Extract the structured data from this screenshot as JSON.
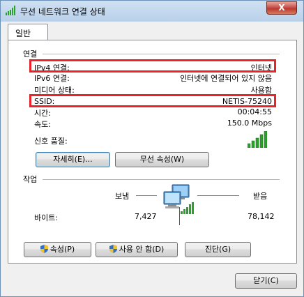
{
  "window": {
    "title": "무선 네트워크 연결 상태",
    "close_label": "X"
  },
  "tab": {
    "label": "일반"
  },
  "connection": {
    "section_label": "연결",
    "rows": [
      {
        "label": "IPv4 연결:",
        "value": "인터넷"
      },
      {
        "label": "IPv6 연결:",
        "value": "인터넷에 연결되어 있지 않음"
      },
      {
        "label": "미디어 상태:",
        "value": "사용함"
      },
      {
        "label": "SSID:",
        "value": "NETIS-75240"
      },
      {
        "label": "시간:",
        "value": "00:04:55"
      },
      {
        "label": "속도:",
        "value": "150.0 Mbps"
      }
    ],
    "signal_label": "신호 품질:",
    "signal_bars": 5,
    "details_button": "자세히(E)...",
    "wireless_props_button": "무선 속성(W)"
  },
  "activity": {
    "section_label": "작업",
    "sent_label": "보냄",
    "received_label": "받음",
    "bytes_label": "바이트:",
    "bytes_sent": "7,427",
    "bytes_received": "78,142"
  },
  "buttons": {
    "properties": "속성(P)",
    "disable": "사용 안 함(D)",
    "diagnose": "진단(G)",
    "close": "닫기(C)"
  },
  "colors": {
    "highlight": "#e8232a",
    "signal": "#2ca02c"
  }
}
